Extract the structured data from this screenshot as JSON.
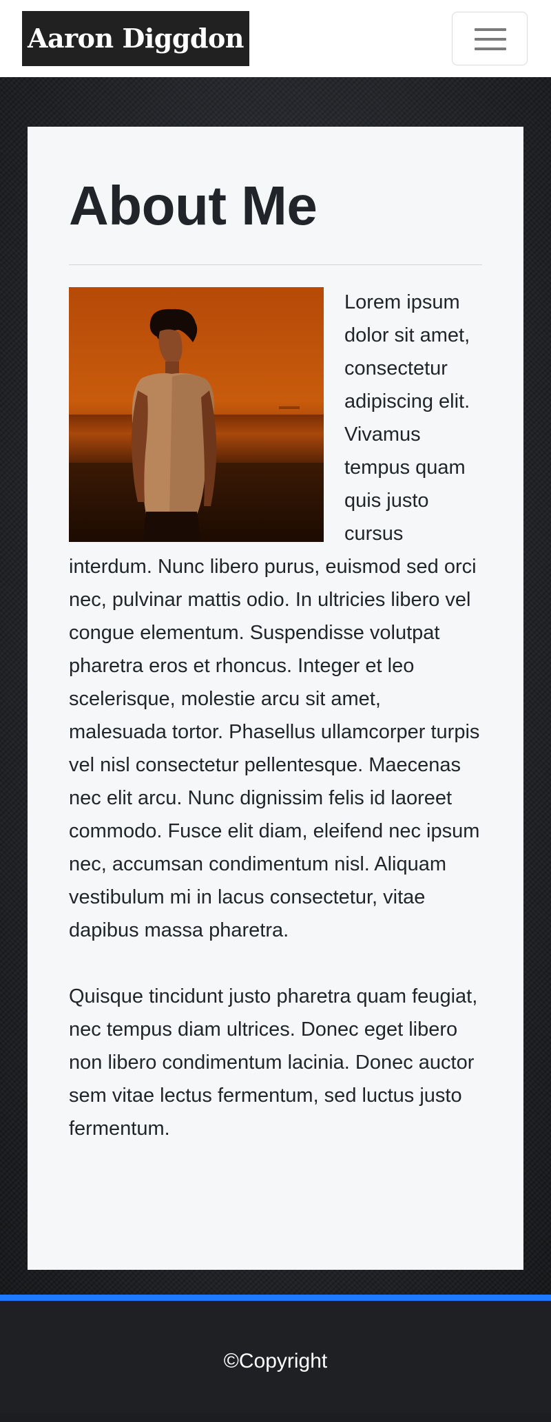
{
  "navbar": {
    "brand": "Aaron Diggdon",
    "toggler_icon": "hamburger-menu-icon"
  },
  "about": {
    "title": "About Me",
    "photo_alt": "portrait-photo",
    "paragraph1": "Lorem ipsum dolor sit amet, consectetur adipiscing elit. Vivamus tempus quam quis justo cursus interdum. Nunc libero purus, euismod sed orci nec, pulvinar mattis odio. In ultricies libero vel congue elementum. Suspendisse volutpat pharetra eros et rhoncus. Integer et leo scelerisque, molestie arcu sit amet, malesuada tortor. Phasellus ullamcorper turpis vel nisl consectetur pellentesque. Maecenas nec elit arcu. Nunc dignissim felis id laoreet commodo. Fusce elit diam, eleifend nec ipsum nec, accumsan condimentum nisl. Aliquam vestibulum mi in lacus consectetur, vitae dapibus massa pharetra.",
    "paragraph2": "Quisque tincidunt justo pharetra quam feugiat, nec tempus diam ultrices. Donec eget libero non libero condimentum lacinia. Donec auctor sem vitae lectus fermentum, sed luctus justo fermentum."
  },
  "footer": {
    "copyright": "©Copyright"
  },
  "colors": {
    "accent": "#1e7bff",
    "brand_bg": "#212121",
    "card_bg": "#f6f7f9",
    "footer_bg": "#1f2023"
  }
}
